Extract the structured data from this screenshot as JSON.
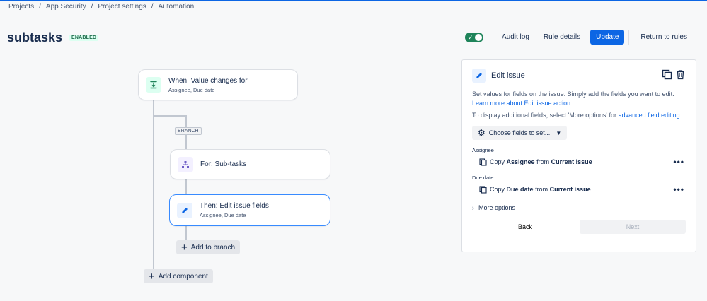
{
  "breadcrumbs": [
    "Projects",
    "App Security",
    "Project settings",
    "Automation"
  ],
  "header": {
    "title": "subtasks",
    "status": "ENABLED",
    "toggle_state": "on",
    "audit_log": "Audit log",
    "rule_details": "Rule details",
    "update": "Update",
    "return": "Return to rules"
  },
  "canvas": {
    "trigger": {
      "title": "When: Value changes for",
      "subtitle": "Assignee, Due date",
      "icon": "field-change-icon"
    },
    "branch_tag": "BRANCH",
    "branch": {
      "title": "For: Sub-tasks",
      "icon": "hierarchy-icon"
    },
    "action": {
      "title": "Then: Edit issue fields",
      "subtitle": "Assignee, Due date",
      "icon": "edit-icon"
    },
    "add_to_branch": "Add to branch",
    "add_component": "Add component"
  },
  "panel": {
    "title": "Edit issue",
    "description": "Set values for fields on the issue. Simply add the fields you want to edit.",
    "learn_more": "Learn more about Edit issue action",
    "extra_prefix": "To display additional fields, select 'More options' for",
    "extra_link": "advanced field editing",
    "extra_suffix": ".",
    "choose_fields": "Choose fields to set...",
    "fields": [
      {
        "label": "Assignee",
        "prefix": "Copy",
        "field": "Assignee",
        "mid": "from",
        "source": "Current issue"
      },
      {
        "label": "Due date",
        "prefix": "Copy",
        "field": "Due date",
        "mid": "from",
        "source": "Current issue"
      }
    ],
    "more_options": "More options",
    "back": "Back",
    "next": "Next"
  },
  "colors": {
    "accent": "#0c66e4",
    "success": "#1f845a",
    "selected_border": "#388bff"
  }
}
